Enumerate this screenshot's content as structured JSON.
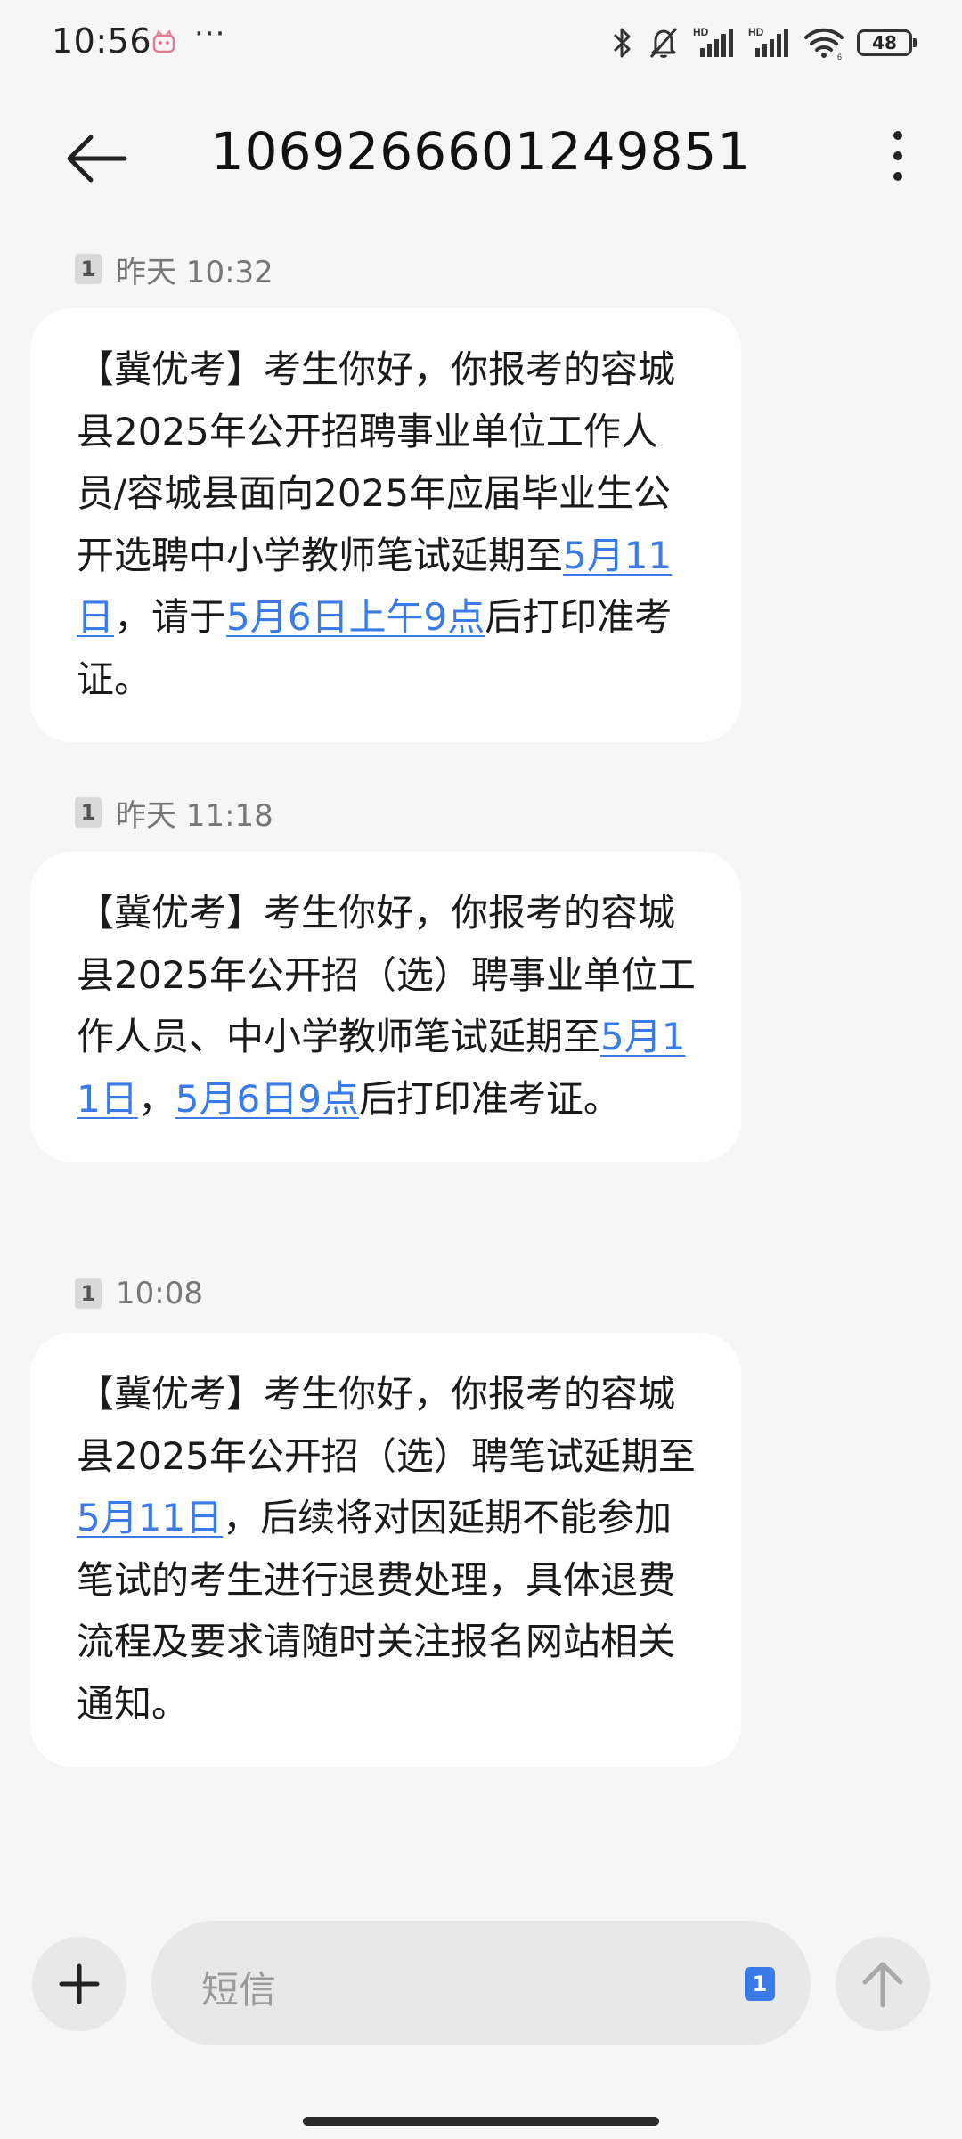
{
  "status_bar": {
    "time": "10:56",
    "more": "···",
    "battery": "48",
    "icons": [
      "app-icon",
      "bluetooth-icon",
      "mute-icon",
      "hd-signal-icon",
      "hd-signal-icon",
      "wifi-icon",
      "battery-icon"
    ]
  },
  "header": {
    "title": "1069266601249851",
    "icons": [
      "back-arrow-icon",
      "more-vertical-icon"
    ]
  },
  "messages": [
    {
      "sim": "1",
      "time": "昨天 10:32",
      "parts": [
        {
          "text": "【冀优考】考生你好，你报考的容城县2025年公开招聘事业单位工作人员/容城县面向2025年应届毕业生公开选聘中小学教师笔试延期至",
          "link": false
        },
        {
          "text": "5月11日",
          "link": true
        },
        {
          "text": "，请于",
          "link": false
        },
        {
          "text": "5月6日上午9点",
          "link": true
        },
        {
          "text": "后打印准考证。",
          "link": false
        }
      ]
    },
    {
      "sim": "1",
      "time": "昨天 11:18",
      "parts": [
        {
          "text": "【冀优考】考生你好，你报考的容城县2025年公开招（选）聘事业单位工作人员、中小学教师笔试延期至",
          "link": false
        },
        {
          "text": "5月11日",
          "link": true
        },
        {
          "text": "，",
          "link": false
        },
        {
          "text": "5月6日9点",
          "link": true
        },
        {
          "text": "后打印准考证。",
          "link": false
        }
      ]
    },
    {
      "sim": "1",
      "time": "10:08",
      "parts": [
        {
          "text": "【冀优考】考生你好，你报考的容城县2025年公开招（选）聘笔试延期至",
          "link": false
        },
        {
          "text": "5月11日",
          "link": true
        },
        {
          "text": "，后续将对因延期不能参加笔试的考生进行退费处理，具体退费流程及要求请随时关注报名网站相关通知。",
          "link": false
        }
      ]
    }
  ],
  "composer": {
    "placeholder": "短信",
    "sim": "1",
    "icons": [
      "plus-icon",
      "send-arrow-icon"
    ]
  },
  "colors": {
    "background": "#f6f6f6",
    "bubble": "#ffffff",
    "link": "#3b7be8",
    "control": "#e8e8e8"
  }
}
